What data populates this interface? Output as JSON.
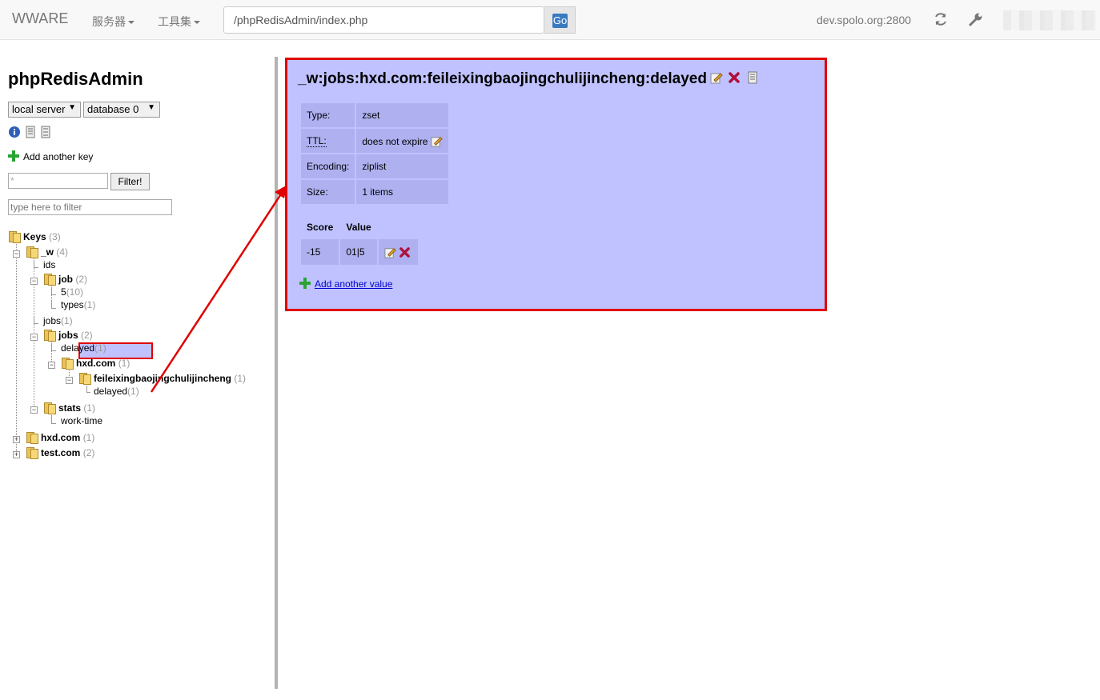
{
  "navbar": {
    "brand": "WWARE",
    "menu_servers": "服务器",
    "menu_tools": "工具集",
    "url_value": "/phpRedisAdmin/index.php",
    "go_label": "Go",
    "host": "dev.spolo.org:2800",
    "icons": [
      "refresh-icon",
      "wrench-icon"
    ]
  },
  "sidebar": {
    "title": "phpRedisAdmin",
    "server_select": "local server",
    "database_select": "database 0",
    "add_key_label": "Add another key",
    "filter_value": "*",
    "filter_button": "Filter!",
    "search_placeholder": "type here to filter"
  },
  "tree": {
    "root": {
      "label": "Keys",
      "count": "(3)"
    },
    "w": {
      "label": "_w",
      "count": "(4)"
    },
    "ids": {
      "label": "ids"
    },
    "job": {
      "label": "job",
      "count": "(2)"
    },
    "job_5": {
      "label": "5",
      "count": "(10)"
    },
    "job_types": {
      "label": "types",
      "count": "(1)"
    },
    "jobs_leaf": {
      "label": "jobs",
      "count": "(1)"
    },
    "jobs": {
      "label": "jobs",
      "count": "(2)"
    },
    "jobs_delayed": {
      "label": "delayed",
      "count": "(1)"
    },
    "hxd_inner": {
      "label": "hxd.com",
      "count": "(1)"
    },
    "feilei": {
      "label": "feileixingbaojingchulijincheng",
      "count": "(1)"
    },
    "selected": {
      "label": "delayed",
      "count": "(1)"
    },
    "stats": {
      "label": "stats",
      "count": "(1)"
    },
    "work_time": {
      "label": "work-time"
    },
    "hxd_top": {
      "label": "hxd.com",
      "count": "(1)"
    },
    "test_top": {
      "label": "test.com",
      "count": "(2)"
    }
  },
  "key": {
    "name": "_w:jobs:hxd.com:feileixingbaojingchulijincheng:delayed",
    "type_label": "Type:",
    "type_value": "zset",
    "ttl_label": "TTL:",
    "ttl_value": "does not expire",
    "encoding_label": "Encoding:",
    "encoding_value": "ziplist",
    "size_label": "Size:",
    "size_value": "1 items",
    "col_score": "Score",
    "col_value": "Value",
    "rows": [
      {
        "score": "-15",
        "value": "01|5"
      }
    ],
    "add_value_label": "Add another value"
  },
  "colors": {
    "panel_bg": "#c0c2ff",
    "highlight_border": "#e00000",
    "cell_bg": "#aeb0f0"
  }
}
